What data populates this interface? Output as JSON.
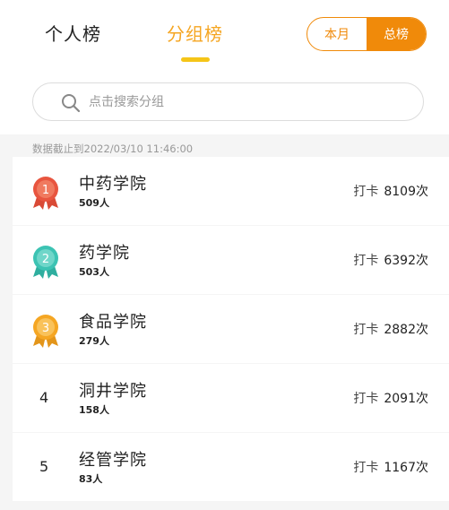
{
  "tabs": {
    "personal": "个人榜",
    "group": "分组榜",
    "active": "group"
  },
  "period": {
    "month": "本月",
    "total": "总榜",
    "active": "total"
  },
  "search": {
    "placeholder": "点击搜索分组",
    "value": ""
  },
  "timestamp": "数据截止到2022/03/10 11:46:00",
  "colors": {
    "accent": "#f08a0a",
    "tab_active": "#f5a623",
    "medal_gold": "#f5a623",
    "medal_silver": "#3cc3b3",
    "medal_bronze": "#e8553f"
  },
  "ranking": [
    {
      "rank": "1",
      "medal": "red-medal-icon",
      "name": "中药学院",
      "members": "509人",
      "punch_label": "打卡",
      "punch_count": "8109次"
    },
    {
      "rank": "2",
      "medal": "teal-medal-icon",
      "name": "药学院",
      "members": "503人",
      "punch_label": "打卡",
      "punch_count": "6392次"
    },
    {
      "rank": "3",
      "medal": "gold-medal-icon",
      "name": "食品学院",
      "members": "279人",
      "punch_label": "打卡",
      "punch_count": "2882次"
    },
    {
      "rank": "4",
      "medal": "",
      "name": "洞井学院",
      "members": "158人",
      "punch_label": "打卡",
      "punch_count": "2091次"
    },
    {
      "rank": "5",
      "medal": "",
      "name": "经管学院",
      "members": "83人",
      "punch_label": "打卡",
      "punch_count": "1167次"
    }
  ]
}
